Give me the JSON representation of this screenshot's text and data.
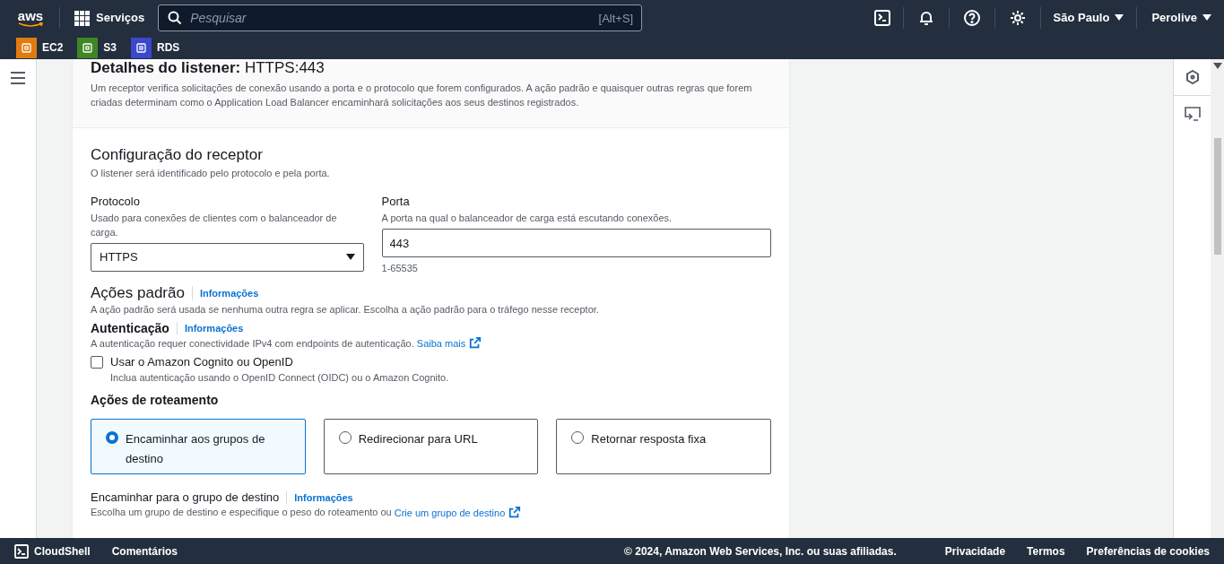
{
  "nav": {
    "logo": "aws",
    "services": "Serviços",
    "search_placeholder": "Pesquisar",
    "search_shortcut": "[Alt+S]",
    "region": "São Paulo",
    "account": "Perolive"
  },
  "favorites": [
    {
      "label": "EC2",
      "color": "#e07b10"
    },
    {
      "label": "S3",
      "color": "#3f8624"
    },
    {
      "label": "RDS",
      "color": "#3b48cc"
    }
  ],
  "panel": {
    "header_title": "**Detalhes do listener:** HTTPS:443",
    "header_description": "Um receptor verifica solicitações de conexão usando a porta e o protocolo que forem configurados. A ação padrão e quaisquer outras regras que forem criadas determinam como o Application Load Balancer encaminhará solicitações aos seus destinos registrados.",
    "section_title": "Configuração do receptor",
    "section_description": "O listener será identificado pelo protocolo e pela porta.",
    "protocol": {
      "label": "Protocolo",
      "description": "Usado para conexões de clientes com o balanceador de carga.",
      "value": "HTTPS"
    },
    "port": {
      "label": "Porta",
      "description": "A porta na qual o balanceador de carga está escutando conexões.",
      "value": "443",
      "constraint": "1-65535"
    },
    "default_actions": {
      "title": "Ações padrão",
      "info": "Informações",
      "description": "A ação padrão será usada se nenhuma outra regra se aplicar. Escolha a ação padrão para o tráfego nesse receptor."
    },
    "authentication": {
      "title": "Autenticação",
      "info": "Informações",
      "description": "A autenticação requer conectividade IPv4 com endpoints de autenticação.",
      "link": "Saiba mais",
      "checkbox": {
        "label": "Usar o Amazon Cognito ou OpenID",
        "description": "Inclua autenticação usando o OpenID Connect (OIDC) ou o Amazon Cognito.",
        "checked": false
      }
    },
    "routing": {
      "title": "Ações de roteamento",
      "options": [
        {
          "label": "Encaminhar aos grupos de destino",
          "selected": true
        },
        {
          "label": "Redirecionar para URL",
          "selected": false
        },
        {
          "label": "Retornar resposta fixa",
          "selected": false
        }
      ]
    },
    "forward": {
      "title": "Encaminhar para o grupo de destino",
      "info": "Informações",
      "description": "Escolha um grupo de destino e especifique o peso do roteamento ou",
      "link": "Crie um grupo de destino"
    }
  },
  "footer": {
    "cloudshell": "CloudShell",
    "feedback": "Comentários",
    "copyright": "© 2024, Amazon Web Services, Inc. ou suas afiliadas.",
    "links": [
      "Privacidade",
      "Termos",
      "Preferências de cookies"
    ]
  }
}
